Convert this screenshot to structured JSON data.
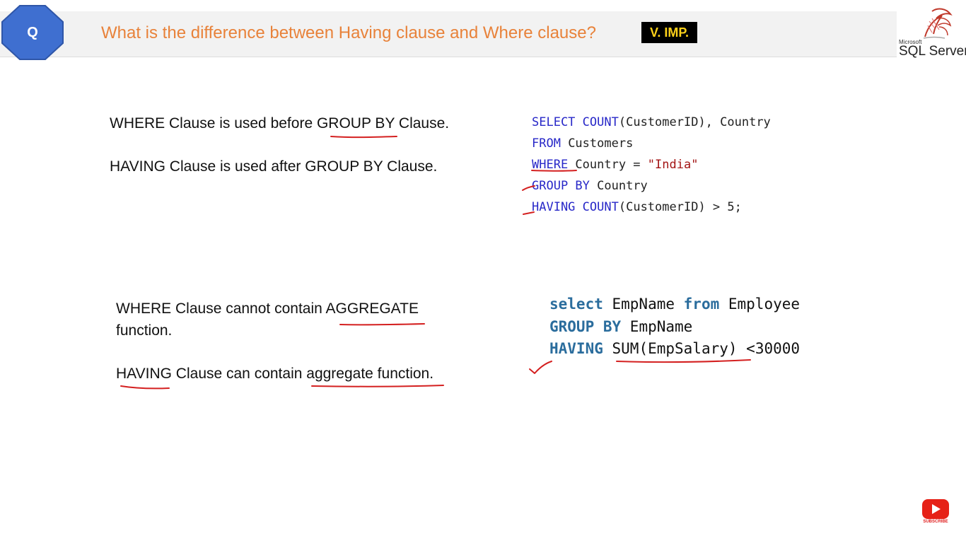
{
  "header": {
    "badge_letter": "Q",
    "title": "What is the difference between Having clause and Where clause?",
    "tag": "V. IMP.",
    "logo_small": "Microsoft",
    "logo_text": "SQL Server"
  },
  "section1": {
    "line1_before": "WHERE Clause is used before ",
    "line1_underlined": "GROUP BY",
    "line1_after": " Clause.",
    "line2": "HAVING Clause is used after GROUP BY Clause."
  },
  "code1": {
    "l1_kw": "SELECT",
    "l1_fn": "COUNT",
    "l1_rest": "(CustomerID), Country",
    "l2_kw": "FROM",
    "l2_rest": " Customers",
    "l3_kw": "WHERE",
    "l3_rest": " Country = ",
    "l3_str": "\"India\"",
    "l4_kw": "GROUP BY",
    "l4_rest": " Country",
    "l5_kw": "HAVING",
    "l5_fn": "COUNT",
    "l5_rest": "(CustomerID) > 5;"
  },
  "section2": {
    "line1_before": "WHERE Clause cannot contain ",
    "line1_underlined": "AGGREGATE",
    "line2": "function.",
    "line3_underlined1": "HAVING",
    "line3_mid": " Clause can contain ",
    "line3_underlined2": "aggregate function",
    "line3_end": "."
  },
  "code2": {
    "l1_kw1": "select",
    "l1_t1": " EmpName ",
    "l1_kw2": "from",
    "l1_t2": " Employee",
    "l2_kw": "GROUP BY",
    "l2_t": " EmpName",
    "l3_kw": "HAVING",
    "l3_fn": "SUM(EmpSalary)",
    "l3_t": " <30000"
  },
  "youtube": {
    "label": "SUBSCRIBE"
  },
  "colors": {
    "badge": "#3f6fd0",
    "title": "#e8823a",
    "tag_bg": "#000000",
    "tag_text": "#ffd21a",
    "keyword": "#2828c8",
    "keyword_bold": "#2b6d9d",
    "string": "#a31515",
    "ink": "#d42020"
  }
}
